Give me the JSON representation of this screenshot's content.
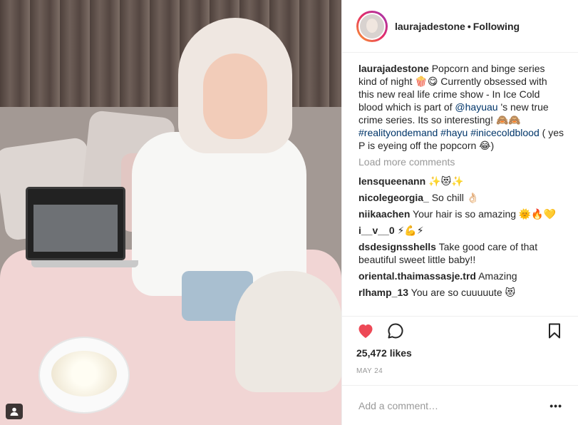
{
  "header": {
    "username": "laurajadestone",
    "separator": "•",
    "follow_status": "Following"
  },
  "caption": {
    "username": "laurajadestone",
    "text_1": " Popcorn and binge series kind of night 🍿😋  Currently obsessed with this new real life crime show - In Ice Cold blood which is part of ",
    "mention": "@hayuau",
    "text_2": " 's new true crime series. Its so interesting! 🙈🙈 ",
    "tags": "#realityondemand #hayu #inicecoldblood",
    "text_3": " ( yes P is eyeing off the popcorn 😂)"
  },
  "load_more": "Load more comments",
  "comments": [
    {
      "user": "lensqueenann",
      "text": " ✨😻✨"
    },
    {
      "user": "nicolegeorgia_",
      "text": " So chill 👌🏻"
    },
    {
      "user": "niikaachen",
      "text": " Your hair is so amazing 🌞🔥💛"
    },
    {
      "user": "i__v__0",
      "text": " ⚡💪⚡"
    },
    {
      "user": "dsdesignsshells",
      "text": " Take good care of that beautiful sweet little baby!!"
    },
    {
      "user": "oriental.thaimassasje.trd",
      "text": " Amazing"
    },
    {
      "user": "rlhamp_13",
      "text": " You are so cuuuuute 😻"
    }
  ],
  "likes": "25,472 likes",
  "date": "MAY 24",
  "add_comment_placeholder": "Add a comment…",
  "more_label": "•••",
  "colors": {
    "heart": "#ed4956",
    "link": "#003569",
    "muted": "#999999"
  },
  "icons": {
    "like": "heart-icon",
    "comment": "comment-icon",
    "save": "bookmark-icon",
    "tag": "user-tag-icon"
  }
}
